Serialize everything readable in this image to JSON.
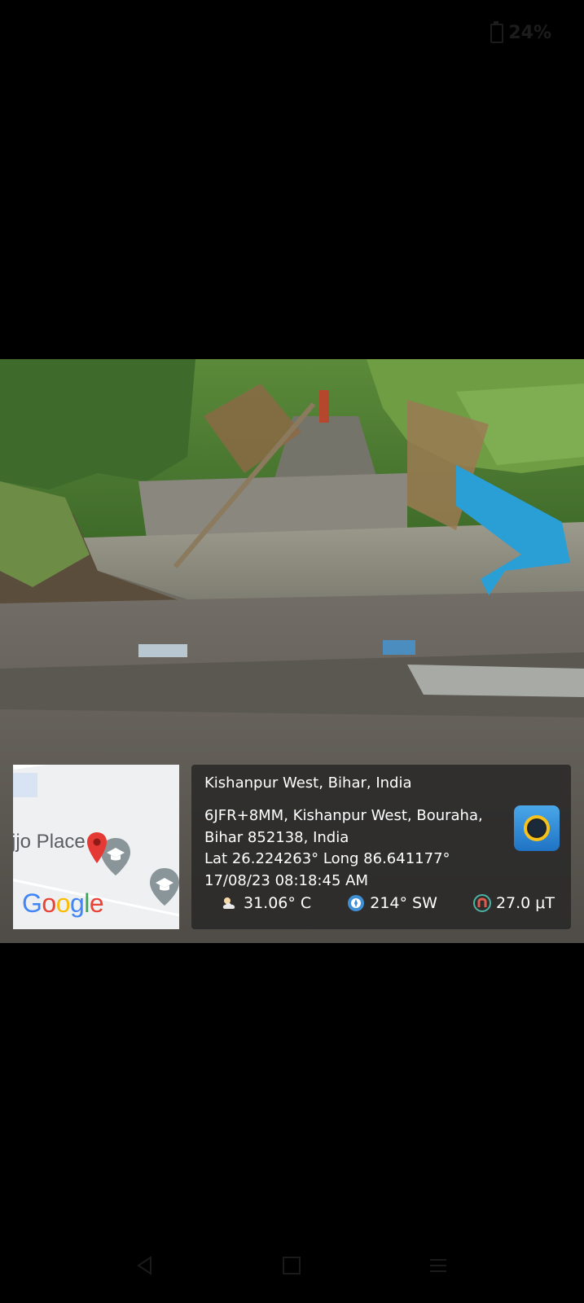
{
  "status_bar": {
    "battery_percent": "24%"
  },
  "photo": {
    "description_icon": "photo-icon"
  },
  "map": {
    "place_label": "jjo Place",
    "google_logo": [
      "G",
      "o",
      "o",
      "g",
      "l",
      "e"
    ]
  },
  "info": {
    "title": "Kishanpur West, Bihar, India",
    "address_line1": "6JFR+8MM, Kishanpur West, Bouraha,",
    "address_line2": "Bihar 852138, India",
    "coordinates": "Lat 26.224263° Long 86.641177°",
    "datetime": "17/08/23 08:18:45 AM",
    "temperature": "31.06° C",
    "wind": "214° SW",
    "magnetic": "27.0 μT"
  },
  "colors": {
    "overlay_bg": "#262626",
    "pin": "#e53935",
    "app_icon": "#1f73c4"
  }
}
